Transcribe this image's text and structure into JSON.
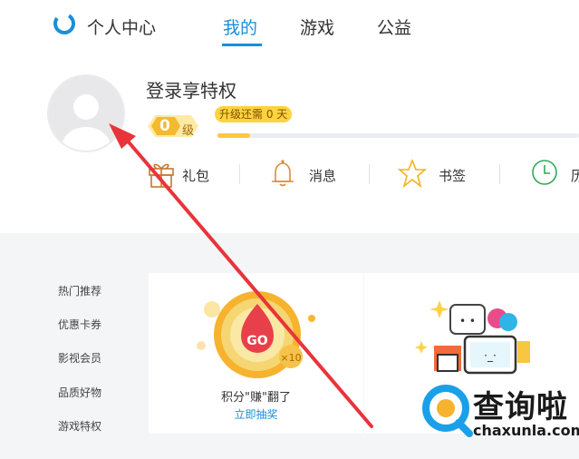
{
  "header": {
    "app_title": "个人中心",
    "tabs": [
      {
        "label": "我的",
        "active": true
      },
      {
        "label": "游戏",
        "active": false
      },
      {
        "label": "公益",
        "active": false
      }
    ]
  },
  "profile": {
    "login_text": "登录享特权",
    "level_number": "0",
    "level_suffix": "级",
    "upgrade_text": "升级还需 0 天",
    "progress_fraction": 0.09
  },
  "quick_items": [
    {
      "label": "礼包",
      "icon": "gift-icon"
    },
    {
      "label": "消息",
      "icon": "bell-icon"
    },
    {
      "label": "书签",
      "icon": "star-icon"
    },
    {
      "label": "历",
      "icon": "clock-icon"
    }
  ],
  "sidebar": {
    "items": [
      "热门推荐",
      "优惠卡券",
      "影视会员",
      "品质好物",
      "游戏特权"
    ]
  },
  "cards": [
    {
      "title": "积分\"赚\"翻了",
      "link": "立即抽奖",
      "badge": "GO",
      "multiplier": "×10"
    }
  ],
  "watermark": {
    "text": "查询啦",
    "url": "chaxunla.com"
  },
  "colors": {
    "accent": "#1a8fd8",
    "gold": "#ffc83d",
    "annotation": "#e8343a"
  }
}
